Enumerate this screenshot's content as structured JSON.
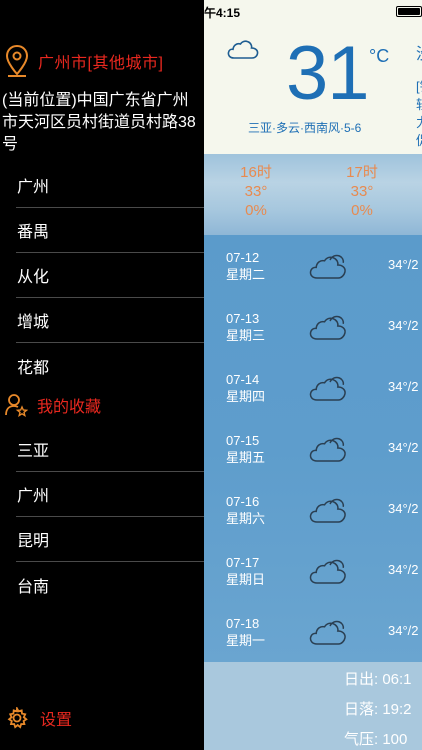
{
  "sidebar": {
    "current_city_title": "广州市[其他城市]",
    "address": "(当前位置)中国广东省广州市天河区员村街道员村路38号",
    "cities": [
      "广州",
      "番禺",
      "从化",
      "增城",
      "花都"
    ],
    "favorites_title": "我的收藏",
    "favorites": [
      "三亚",
      "广州",
      "昆明",
      "台南"
    ],
    "settings_label": "设置",
    "accent_color": "#e8281f"
  },
  "status_bar": {
    "time": "午4:15"
  },
  "current": {
    "icon": "cloud-icon",
    "temperature": "31",
    "unit": "°C",
    "description": "三亚·多云·西南风·5-6",
    "side_text_1": "没",
    "side_text_2": "[钥",
    "side_text_3": "轻",
    "side_text_4": "力",
    "side_text_5": "促"
  },
  "hourly": [
    {
      "time": "16时",
      "temp": "33°",
      "precip": "0%"
    },
    {
      "time": "17时",
      "temp": "33°",
      "precip": "0%"
    }
  ],
  "daily": [
    {
      "date": "07-12",
      "weekday": "星期二",
      "icon": "cloud-icon",
      "temp": "34°/2"
    },
    {
      "date": "07-13",
      "weekday": "星期三",
      "icon": "cloud-icon",
      "temp": "34°/2"
    },
    {
      "date": "07-14",
      "weekday": "星期四",
      "icon": "cloud-icon",
      "temp": "34°/2"
    },
    {
      "date": "07-15",
      "weekday": "星期五",
      "icon": "cloud-icon",
      "temp": "34°/2"
    },
    {
      "date": "07-16",
      "weekday": "星期六",
      "icon": "cloud-icon",
      "temp": "34°/2"
    },
    {
      "date": "07-17",
      "weekday": "星期日",
      "icon": "cloud-icon",
      "temp": "34°/2"
    },
    {
      "date": "07-18",
      "weekday": "星期一",
      "icon": "cloud-icon",
      "temp": "34°/2"
    }
  ],
  "sun": {
    "sunrise": "日出: 06:1",
    "sunset": "日落: 19:2",
    "pressure": "气压: 100"
  }
}
